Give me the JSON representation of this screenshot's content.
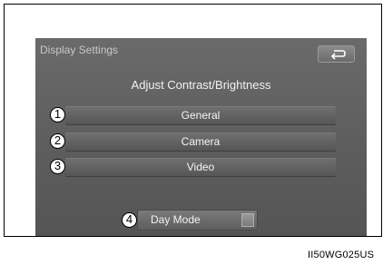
{
  "screen": {
    "title": "Display Settings",
    "back_icon": "back-arrow-icon",
    "subtitle": "Adjust Contrast/Brightness"
  },
  "menu": [
    {
      "label": "General",
      "callout": "1"
    },
    {
      "label": "Camera",
      "callout": "2"
    },
    {
      "label": "Video",
      "callout": "3"
    }
  ],
  "day_mode": {
    "label": "Day Mode",
    "callout": "4",
    "on": false
  },
  "figure_code": "II50WG025US"
}
